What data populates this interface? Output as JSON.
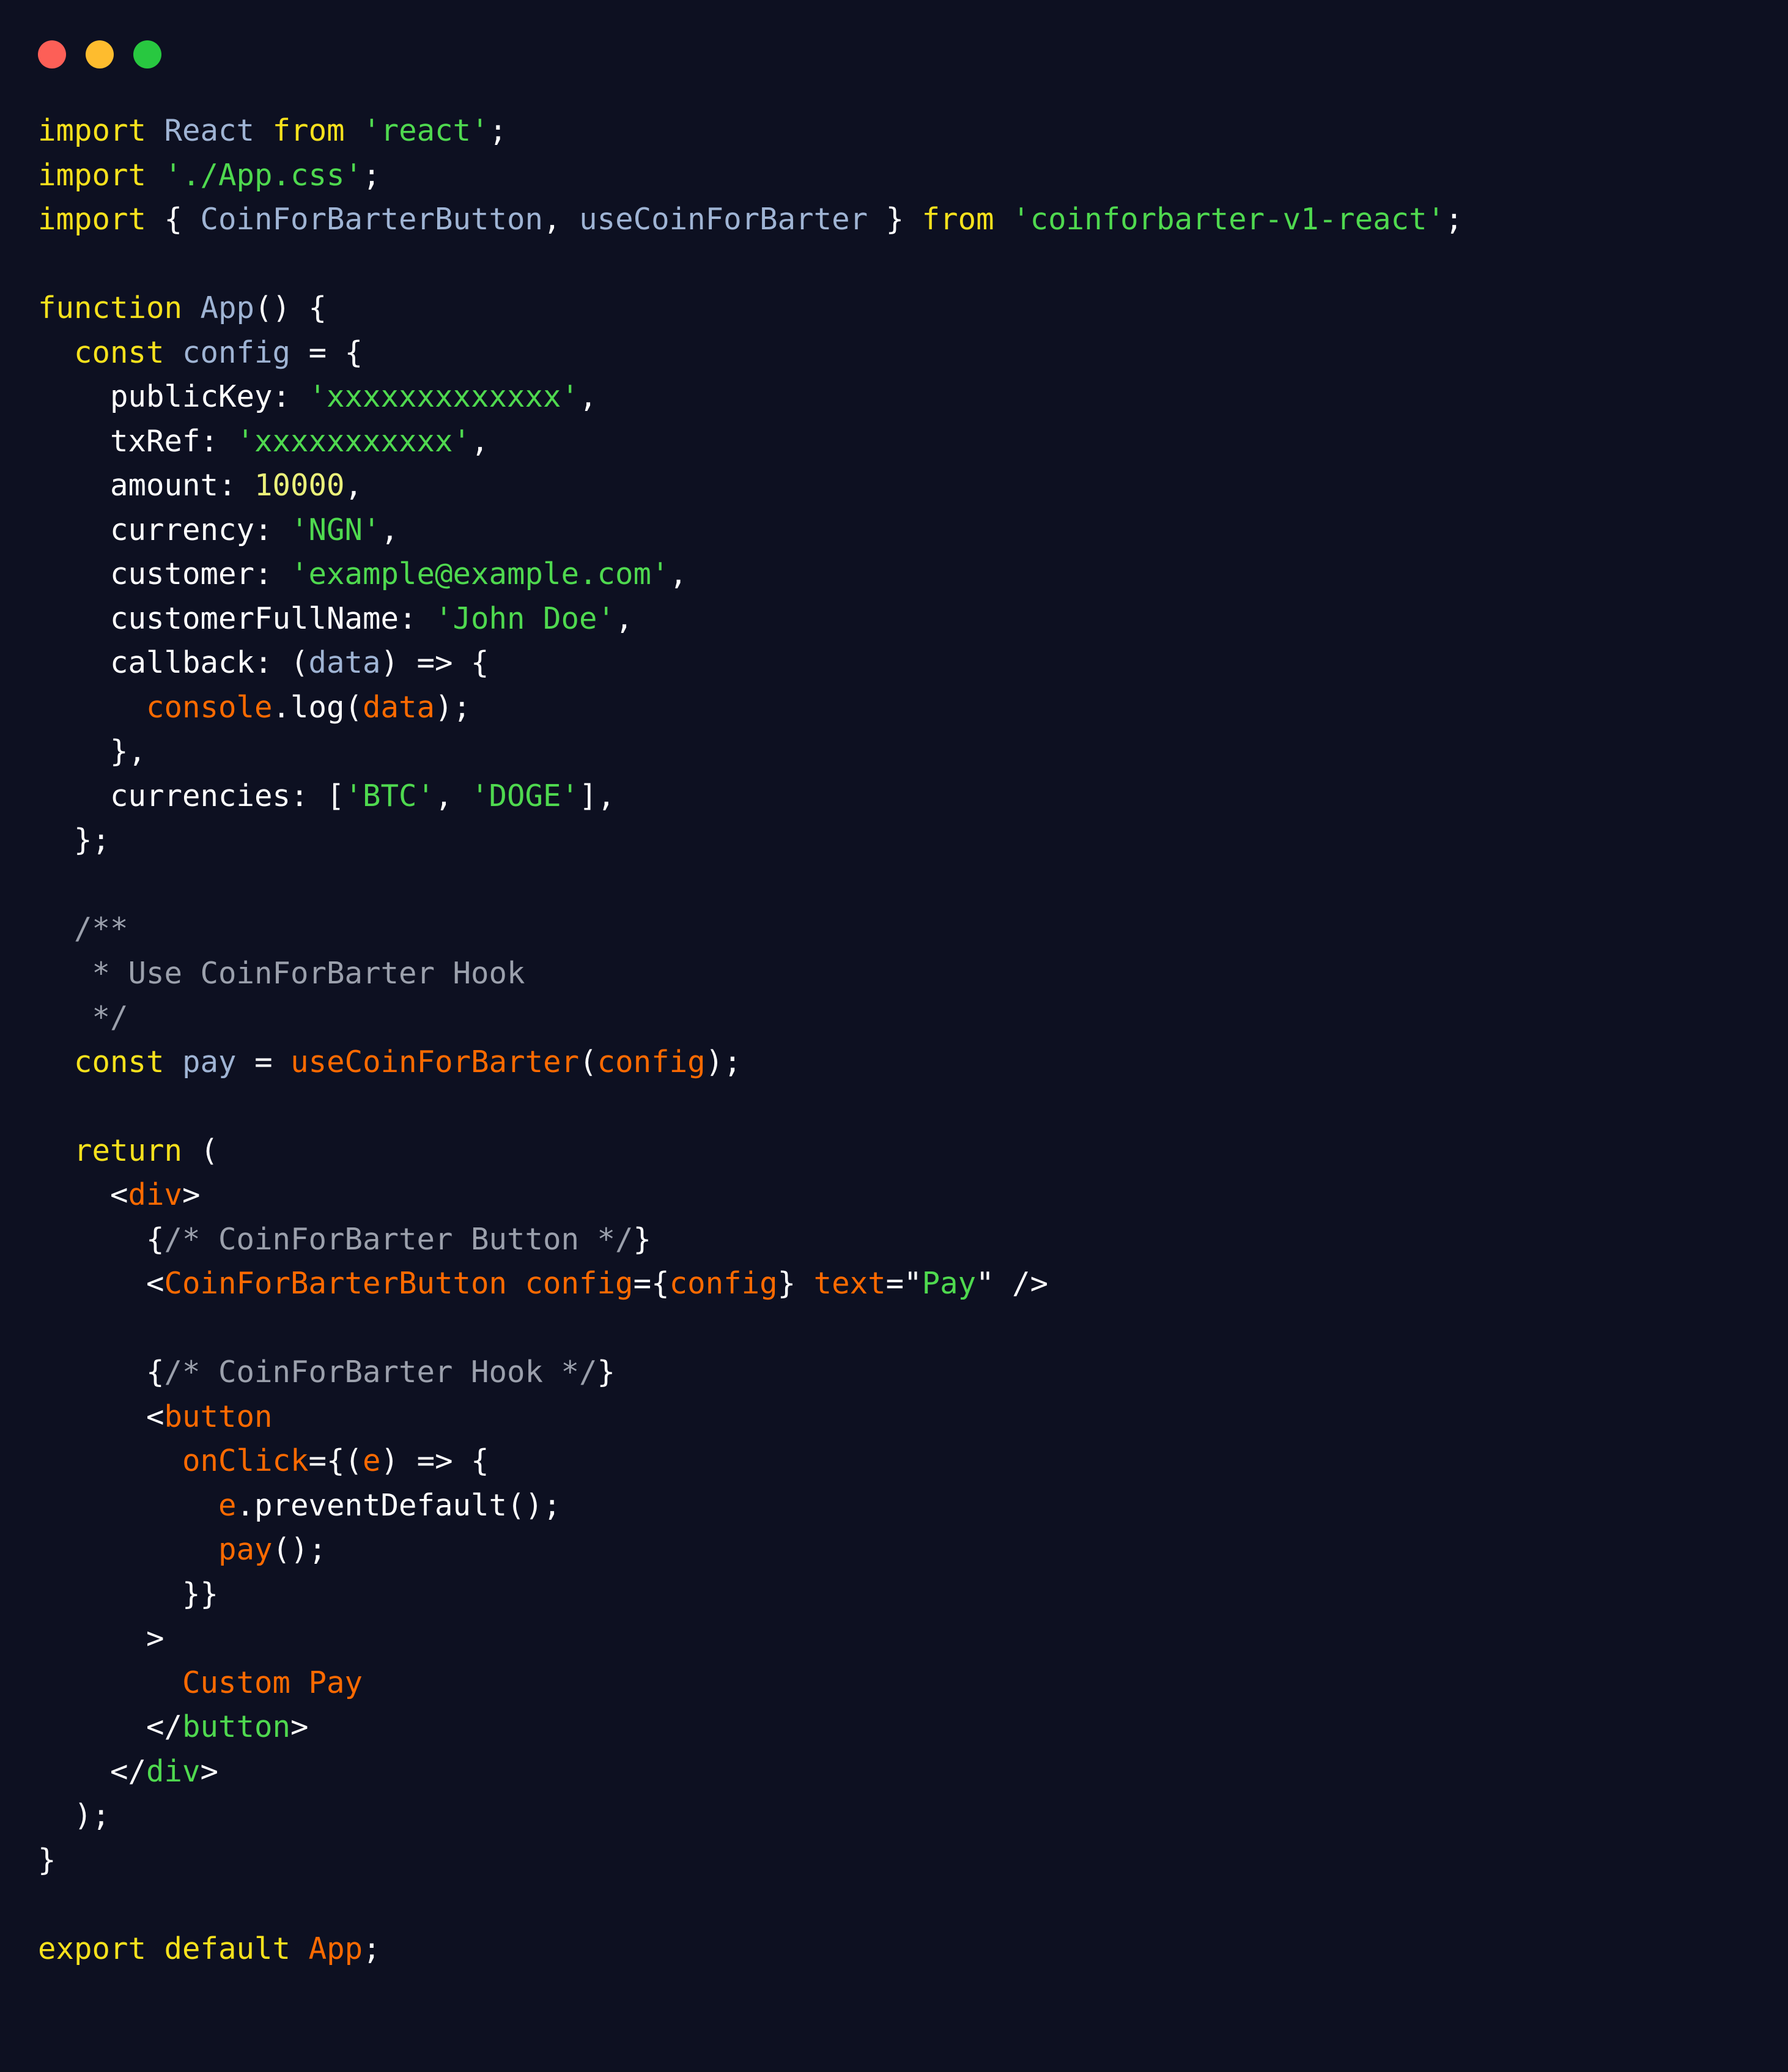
{
  "window": {
    "controls": [
      {
        "name": "close",
        "color": "#fd5f57"
      },
      {
        "name": "minimize",
        "color": "#febc2e"
      },
      {
        "name": "maximize",
        "color": "#28c840"
      }
    ]
  },
  "editor": {
    "language": "jsx",
    "background": "#0d1021",
    "theme_colors": {
      "keyword": "#f7e11c",
      "identifier": "#9fb4d4",
      "string": "#4fd94f",
      "number": "#eaf07a",
      "punctuation": "#ffffff",
      "comment": "#9ba0ac",
      "function": "#ff6a00",
      "closing_tag": "#4fd94f"
    },
    "lines": [
      {
        "id": 1,
        "tokens": [
          {
            "t": "import",
            "c": "kw"
          },
          {
            "t": " ",
            "c": "pun"
          },
          {
            "t": "React",
            "c": "id"
          },
          {
            "t": " ",
            "c": "pun"
          },
          {
            "t": "from",
            "c": "kw"
          },
          {
            "t": " ",
            "c": "pun"
          },
          {
            "t": "'react'",
            "c": "str"
          },
          {
            "t": ";",
            "c": "pun"
          }
        ]
      },
      {
        "id": 2,
        "tokens": [
          {
            "t": "import",
            "c": "kw"
          },
          {
            "t": " ",
            "c": "pun"
          },
          {
            "t": "'./App.css'",
            "c": "str"
          },
          {
            "t": ";",
            "c": "pun"
          }
        ]
      },
      {
        "id": 3,
        "tokens": [
          {
            "t": "import",
            "c": "kw"
          },
          {
            "t": " { ",
            "c": "pun"
          },
          {
            "t": "CoinForBarterButton",
            "c": "id"
          },
          {
            "t": ", ",
            "c": "pun"
          },
          {
            "t": "useCoinForBarter",
            "c": "id"
          },
          {
            "t": " } ",
            "c": "pun"
          },
          {
            "t": "from",
            "c": "kw"
          },
          {
            "t": " ",
            "c": "pun"
          },
          {
            "t": "'coinforbarter-v1-react'",
            "c": "str"
          },
          {
            "t": ";",
            "c": "pun"
          }
        ]
      },
      {
        "id": 4,
        "tokens": []
      },
      {
        "id": 5,
        "tokens": [
          {
            "t": "function",
            "c": "kw"
          },
          {
            "t": " ",
            "c": "pun"
          },
          {
            "t": "App",
            "c": "id"
          },
          {
            "t": "() {",
            "c": "pun"
          }
        ]
      },
      {
        "id": 6,
        "tokens": [
          {
            "t": "  ",
            "c": "pun"
          },
          {
            "t": "const",
            "c": "kw"
          },
          {
            "t": " ",
            "c": "pun"
          },
          {
            "t": "config",
            "c": "id"
          },
          {
            "t": " = {",
            "c": "pun"
          }
        ]
      },
      {
        "id": 7,
        "tokens": [
          {
            "t": "    publicKey: ",
            "c": "pun"
          },
          {
            "t": "'xxxxxxxxxxxxx'",
            "c": "str"
          },
          {
            "t": ",",
            "c": "pun"
          }
        ]
      },
      {
        "id": 8,
        "tokens": [
          {
            "t": "    txRef: ",
            "c": "pun"
          },
          {
            "t": "'xxxxxxxxxxx'",
            "c": "str"
          },
          {
            "t": ",",
            "c": "pun"
          }
        ]
      },
      {
        "id": 9,
        "tokens": [
          {
            "t": "    amount: ",
            "c": "pun"
          },
          {
            "t": "10000",
            "c": "num"
          },
          {
            "t": ",",
            "c": "pun"
          }
        ]
      },
      {
        "id": 10,
        "tokens": [
          {
            "t": "    currency: ",
            "c": "pun"
          },
          {
            "t": "'NGN'",
            "c": "str"
          },
          {
            "t": ",",
            "c": "pun"
          }
        ]
      },
      {
        "id": 11,
        "tokens": [
          {
            "t": "    customer: ",
            "c": "pun"
          },
          {
            "t": "'example@example.com'",
            "c": "str"
          },
          {
            "t": ",",
            "c": "pun"
          }
        ]
      },
      {
        "id": 12,
        "tokens": [
          {
            "t": "    customerFullName: ",
            "c": "pun"
          },
          {
            "t": "'John Doe'",
            "c": "str"
          },
          {
            "t": ",",
            "c": "pun"
          }
        ]
      },
      {
        "id": 13,
        "tokens": [
          {
            "t": "    callback: (",
            "c": "pun"
          },
          {
            "t": "data",
            "c": "id"
          },
          {
            "t": ") => {",
            "c": "pun"
          }
        ]
      },
      {
        "id": 14,
        "tokens": [
          {
            "t": "      ",
            "c": "pun"
          },
          {
            "t": "console",
            "c": "fn"
          },
          {
            "t": ".log(",
            "c": "pun"
          },
          {
            "t": "data",
            "c": "fn"
          },
          {
            "t": ");",
            "c": "pun"
          }
        ]
      },
      {
        "id": 15,
        "tokens": [
          {
            "t": "    },",
            "c": "pun"
          }
        ]
      },
      {
        "id": 16,
        "tokens": [
          {
            "t": "    currencies: [",
            "c": "pun"
          },
          {
            "t": "'BTC'",
            "c": "str"
          },
          {
            "t": ", ",
            "c": "pun"
          },
          {
            "t": "'DOGE'",
            "c": "str"
          },
          {
            "t": "],",
            "c": "pun"
          }
        ]
      },
      {
        "id": 17,
        "tokens": [
          {
            "t": "  };",
            "c": "pun"
          }
        ]
      },
      {
        "id": 18,
        "tokens": []
      },
      {
        "id": 19,
        "tokens": [
          {
            "t": "  /**",
            "c": "com"
          }
        ]
      },
      {
        "id": 20,
        "tokens": [
          {
            "t": "   * Use CoinForBarter Hook",
            "c": "com"
          }
        ]
      },
      {
        "id": 21,
        "tokens": [
          {
            "t": "   */",
            "c": "com"
          }
        ]
      },
      {
        "id": 22,
        "tokens": [
          {
            "t": "  ",
            "c": "pun"
          },
          {
            "t": "const",
            "c": "kw"
          },
          {
            "t": " ",
            "c": "pun"
          },
          {
            "t": "pay",
            "c": "id"
          },
          {
            "t": " = ",
            "c": "pun"
          },
          {
            "t": "useCoinForBarter",
            "c": "fn"
          },
          {
            "t": "(",
            "c": "pun"
          },
          {
            "t": "config",
            "c": "fn"
          },
          {
            "t": ");",
            "c": "pun"
          }
        ]
      },
      {
        "id": 23,
        "tokens": []
      },
      {
        "id": 24,
        "tokens": [
          {
            "t": "  ",
            "c": "pun"
          },
          {
            "t": "return",
            "c": "kw"
          },
          {
            "t": " (",
            "c": "pun"
          }
        ]
      },
      {
        "id": 25,
        "tokens": [
          {
            "t": "    <",
            "c": "pun"
          },
          {
            "t": "div",
            "c": "fn"
          },
          {
            "t": ">",
            "c": "pun"
          }
        ]
      },
      {
        "id": 26,
        "tokens": [
          {
            "t": "      {",
            "c": "pun"
          },
          {
            "t": "/* CoinForBarter Button */",
            "c": "com"
          },
          {
            "t": "}",
            "c": "pun"
          }
        ]
      },
      {
        "id": 27,
        "tokens": [
          {
            "t": "      <",
            "c": "pun"
          },
          {
            "t": "CoinForBarterButton",
            "c": "fn"
          },
          {
            "t": " ",
            "c": "pun"
          },
          {
            "t": "config",
            "c": "fn"
          },
          {
            "t": "={",
            "c": "pun"
          },
          {
            "t": "config",
            "c": "fn"
          },
          {
            "t": "} ",
            "c": "pun"
          },
          {
            "t": "text",
            "c": "fn"
          },
          {
            "t": "=\"",
            "c": "pun"
          },
          {
            "t": "Pay",
            "c": "str"
          },
          {
            "t": "\" />",
            "c": "pun"
          }
        ]
      },
      {
        "id": 28,
        "tokens": []
      },
      {
        "id": 29,
        "tokens": [
          {
            "t": "      {",
            "c": "pun"
          },
          {
            "t": "/* CoinForBarter Hook */",
            "c": "com"
          },
          {
            "t": "}",
            "c": "pun"
          }
        ]
      },
      {
        "id": 30,
        "tokens": [
          {
            "t": "      <",
            "c": "pun"
          },
          {
            "t": "button",
            "c": "fn"
          }
        ]
      },
      {
        "id": 31,
        "tokens": [
          {
            "t": "        ",
            "c": "pun"
          },
          {
            "t": "onClick",
            "c": "fn"
          },
          {
            "t": "={(",
            "c": "pun"
          },
          {
            "t": "e",
            "c": "fn"
          },
          {
            "t": ") => {",
            "c": "pun"
          }
        ]
      },
      {
        "id": 32,
        "tokens": [
          {
            "t": "          ",
            "c": "pun"
          },
          {
            "t": "e",
            "c": "fn"
          },
          {
            "t": ".preventDefault();",
            "c": "pun"
          }
        ]
      },
      {
        "id": 33,
        "tokens": [
          {
            "t": "          ",
            "c": "pun"
          },
          {
            "t": "pay",
            "c": "fn"
          },
          {
            "t": "();",
            "c": "pun"
          }
        ]
      },
      {
        "id": 34,
        "tokens": [
          {
            "t": "        }}",
            "c": "pun"
          }
        ]
      },
      {
        "id": 35,
        "tokens": [
          {
            "t": "      >",
            "c": "pun"
          }
        ]
      },
      {
        "id": 36,
        "tokens": [
          {
            "t": "        ",
            "c": "pun"
          },
          {
            "t": "Custom Pay",
            "c": "fn"
          }
        ]
      },
      {
        "id": 37,
        "tokens": [
          {
            "t": "      </",
            "c": "pun"
          },
          {
            "t": "button",
            "c": "tagc"
          },
          {
            "t": ">",
            "c": "pun"
          }
        ]
      },
      {
        "id": 38,
        "tokens": [
          {
            "t": "    </",
            "c": "pun"
          },
          {
            "t": "div",
            "c": "tagc"
          },
          {
            "t": ">",
            "c": "pun"
          }
        ]
      },
      {
        "id": 39,
        "tokens": [
          {
            "t": "  );",
            "c": "pun"
          }
        ]
      },
      {
        "id": 40,
        "tokens": [
          {
            "t": "}",
            "c": "pun"
          }
        ]
      },
      {
        "id": 41,
        "tokens": []
      },
      {
        "id": 42,
        "tokens": [
          {
            "t": "export",
            "c": "kw"
          },
          {
            "t": " ",
            "c": "pun"
          },
          {
            "t": "default",
            "c": "kw"
          },
          {
            "t": " ",
            "c": "pun"
          },
          {
            "t": "App",
            "c": "fn"
          },
          {
            "t": ";",
            "c": "pun"
          }
        ]
      }
    ]
  }
}
